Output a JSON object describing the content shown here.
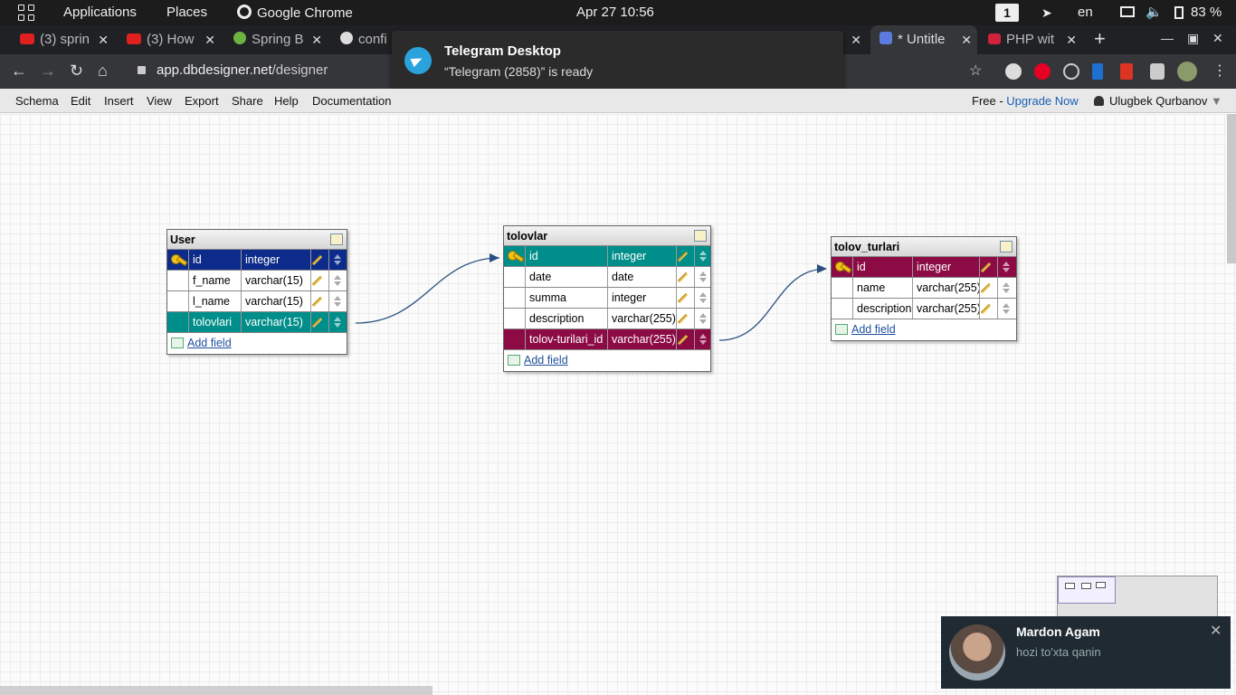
{
  "system": {
    "applications_label": "Applications",
    "places_label": "Places",
    "active_app": "Google Chrome",
    "clock": "Apr 27  10:56",
    "workspace": "1",
    "language": "en",
    "battery": "83 %"
  },
  "browser": {
    "tabs": [
      {
        "label": "(3) sprin",
        "icon": "youtube-icon"
      },
      {
        "label": "(3) How",
        "icon": "youtube-icon"
      },
      {
        "label": "Spring B",
        "icon": "spring-icon"
      },
      {
        "label": "confi",
        "icon": "google-icon"
      },
      {
        "label": "* Untitle",
        "icon": "dbdesigner-icon"
      },
      {
        "label": "PHP wit",
        "icon": "laravel-icon"
      }
    ],
    "url_host": "app.dbdesigner.net",
    "url_path": "/designer"
  },
  "menu": {
    "items": [
      "Schema",
      "Edit",
      "Insert",
      "View",
      "Export",
      "Share",
      "Help",
      "Documentation"
    ],
    "plan_prefix": "Free - ",
    "upgrade": "Upgrade Now",
    "user": "Ulugbek Qurbanov"
  },
  "tables": [
    {
      "name": "User",
      "fields": [
        {
          "name": "id",
          "type": "integer",
          "key": true,
          "color": "navy"
        },
        {
          "name": "f_name",
          "type": "varchar(15)"
        },
        {
          "name": "l_name",
          "type": "varchar(15)"
        },
        {
          "name": "tolovlari",
          "type": "varchar(15)",
          "color": "teal"
        }
      ],
      "add_field": "Add field"
    },
    {
      "name": "tolovlar",
      "fields": [
        {
          "name": "id",
          "type": "integer",
          "key": true,
          "color": "teal"
        },
        {
          "name": "date",
          "type": "date"
        },
        {
          "name": "summa",
          "type": "integer"
        },
        {
          "name": "description",
          "type": "varchar(255)"
        },
        {
          "name": "tolov-turilari_id",
          "type": "varchar(255)",
          "color": "maroon"
        }
      ],
      "add_field": "Add field"
    },
    {
      "name": "tolov_turlari",
      "fields": [
        {
          "name": "id",
          "type": "integer",
          "key": true,
          "color": "maroon"
        },
        {
          "name": "name",
          "type": "varchar(255)"
        },
        {
          "name": "description",
          "type": "varchar(255)"
        }
      ],
      "add_field": "Add field"
    }
  ],
  "notification": {
    "title": "Telegram Desktop",
    "body": "“Telegram (2858)” is ready"
  },
  "chat_popup": {
    "sender": "Mardon Agam",
    "message": "hozi to'xta qanin"
  },
  "colors": {
    "teal": "#008e8a",
    "navy": "#0c2b8a",
    "maroon": "#8c0b45",
    "link": "#1a5fb4"
  }
}
